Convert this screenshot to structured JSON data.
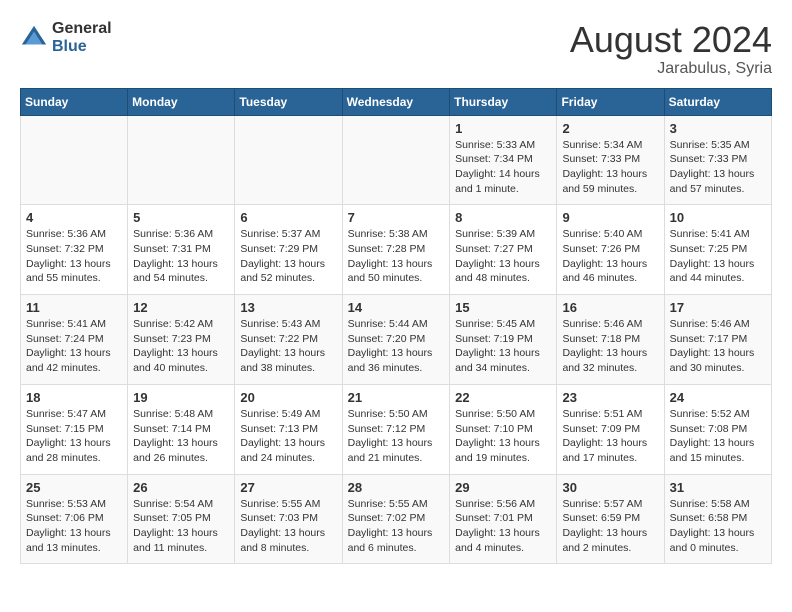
{
  "logo": {
    "general": "General",
    "blue": "Blue"
  },
  "title": {
    "month_year": "August 2024",
    "location": "Jarabulus, Syria"
  },
  "calendar": {
    "headers": [
      "Sunday",
      "Monday",
      "Tuesday",
      "Wednesday",
      "Thursday",
      "Friday",
      "Saturday"
    ],
    "rows": [
      [
        {
          "day": "",
          "info": ""
        },
        {
          "day": "",
          "info": ""
        },
        {
          "day": "",
          "info": ""
        },
        {
          "day": "",
          "info": ""
        },
        {
          "day": "1",
          "info": "Sunrise: 5:33 AM\nSunset: 7:34 PM\nDaylight: 14 hours\nand 1 minute."
        },
        {
          "day": "2",
          "info": "Sunrise: 5:34 AM\nSunset: 7:33 PM\nDaylight: 13 hours\nand 59 minutes."
        },
        {
          "day": "3",
          "info": "Sunrise: 5:35 AM\nSunset: 7:33 PM\nDaylight: 13 hours\nand 57 minutes."
        }
      ],
      [
        {
          "day": "4",
          "info": "Sunrise: 5:36 AM\nSunset: 7:32 PM\nDaylight: 13 hours\nand 55 minutes."
        },
        {
          "day": "5",
          "info": "Sunrise: 5:36 AM\nSunset: 7:31 PM\nDaylight: 13 hours\nand 54 minutes."
        },
        {
          "day": "6",
          "info": "Sunrise: 5:37 AM\nSunset: 7:29 PM\nDaylight: 13 hours\nand 52 minutes."
        },
        {
          "day": "7",
          "info": "Sunrise: 5:38 AM\nSunset: 7:28 PM\nDaylight: 13 hours\nand 50 minutes."
        },
        {
          "day": "8",
          "info": "Sunrise: 5:39 AM\nSunset: 7:27 PM\nDaylight: 13 hours\nand 48 minutes."
        },
        {
          "day": "9",
          "info": "Sunrise: 5:40 AM\nSunset: 7:26 PM\nDaylight: 13 hours\nand 46 minutes."
        },
        {
          "day": "10",
          "info": "Sunrise: 5:41 AM\nSunset: 7:25 PM\nDaylight: 13 hours\nand 44 minutes."
        }
      ],
      [
        {
          "day": "11",
          "info": "Sunrise: 5:41 AM\nSunset: 7:24 PM\nDaylight: 13 hours\nand 42 minutes."
        },
        {
          "day": "12",
          "info": "Sunrise: 5:42 AM\nSunset: 7:23 PM\nDaylight: 13 hours\nand 40 minutes."
        },
        {
          "day": "13",
          "info": "Sunrise: 5:43 AM\nSunset: 7:22 PM\nDaylight: 13 hours\nand 38 minutes."
        },
        {
          "day": "14",
          "info": "Sunrise: 5:44 AM\nSunset: 7:20 PM\nDaylight: 13 hours\nand 36 minutes."
        },
        {
          "day": "15",
          "info": "Sunrise: 5:45 AM\nSunset: 7:19 PM\nDaylight: 13 hours\nand 34 minutes."
        },
        {
          "day": "16",
          "info": "Sunrise: 5:46 AM\nSunset: 7:18 PM\nDaylight: 13 hours\nand 32 minutes."
        },
        {
          "day": "17",
          "info": "Sunrise: 5:46 AM\nSunset: 7:17 PM\nDaylight: 13 hours\nand 30 minutes."
        }
      ],
      [
        {
          "day": "18",
          "info": "Sunrise: 5:47 AM\nSunset: 7:15 PM\nDaylight: 13 hours\nand 28 minutes."
        },
        {
          "day": "19",
          "info": "Sunrise: 5:48 AM\nSunset: 7:14 PM\nDaylight: 13 hours\nand 26 minutes."
        },
        {
          "day": "20",
          "info": "Sunrise: 5:49 AM\nSunset: 7:13 PM\nDaylight: 13 hours\nand 24 minutes."
        },
        {
          "day": "21",
          "info": "Sunrise: 5:50 AM\nSunset: 7:12 PM\nDaylight: 13 hours\nand 21 minutes."
        },
        {
          "day": "22",
          "info": "Sunrise: 5:50 AM\nSunset: 7:10 PM\nDaylight: 13 hours\nand 19 minutes."
        },
        {
          "day": "23",
          "info": "Sunrise: 5:51 AM\nSunset: 7:09 PM\nDaylight: 13 hours\nand 17 minutes."
        },
        {
          "day": "24",
          "info": "Sunrise: 5:52 AM\nSunset: 7:08 PM\nDaylight: 13 hours\nand 15 minutes."
        }
      ],
      [
        {
          "day": "25",
          "info": "Sunrise: 5:53 AM\nSunset: 7:06 PM\nDaylight: 13 hours\nand 13 minutes."
        },
        {
          "day": "26",
          "info": "Sunrise: 5:54 AM\nSunset: 7:05 PM\nDaylight: 13 hours\nand 11 minutes."
        },
        {
          "day": "27",
          "info": "Sunrise: 5:55 AM\nSunset: 7:03 PM\nDaylight: 13 hours\nand 8 minutes."
        },
        {
          "day": "28",
          "info": "Sunrise: 5:55 AM\nSunset: 7:02 PM\nDaylight: 13 hours\nand 6 minutes."
        },
        {
          "day": "29",
          "info": "Sunrise: 5:56 AM\nSunset: 7:01 PM\nDaylight: 13 hours\nand 4 minutes."
        },
        {
          "day": "30",
          "info": "Sunrise: 5:57 AM\nSunset: 6:59 PM\nDaylight: 13 hours\nand 2 minutes."
        },
        {
          "day": "31",
          "info": "Sunrise: 5:58 AM\nSunset: 6:58 PM\nDaylight: 13 hours\nand 0 minutes."
        }
      ]
    ]
  }
}
